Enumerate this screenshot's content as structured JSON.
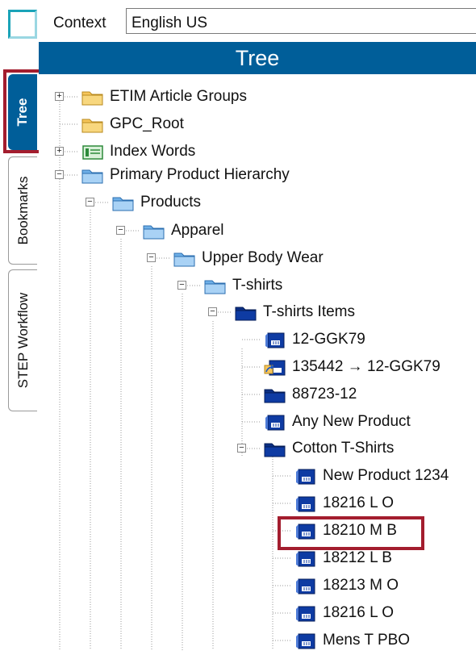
{
  "context": {
    "label": "Context",
    "value": "English US"
  },
  "left_tabs": [
    {
      "label": "Tree",
      "active": true
    },
    {
      "label": "Bookmarks",
      "active": false
    },
    {
      "label": "STEP Workflow",
      "active": false
    }
  ],
  "panel": {
    "title": "Tree"
  },
  "colors": {
    "header_blue": "#005e99",
    "highlight_red": "#a31d2e",
    "accent_teal": "#1aa3b8"
  },
  "tree": [
    {
      "label": "ETIM Article Groups",
      "icon": "folder-yellow-icon",
      "expander": "+"
    },
    {
      "label": "GPC_Root",
      "icon": "folder-yellow-icon",
      "expander": ""
    },
    {
      "label": "Index Words",
      "icon": "index-book-icon",
      "expander": "+"
    },
    {
      "label": "Primary Product Hierarchy",
      "icon": "folder-blue-icon",
      "expander": "-"
    },
    {
      "label": "Products",
      "icon": "folder-blue-icon",
      "expander": "-"
    },
    {
      "label": "Apparel",
      "icon": "folder-blue-icon",
      "expander": "-"
    },
    {
      "label": "Upper Body Wear",
      "icon": "folder-blue-icon",
      "expander": "-"
    },
    {
      "label": "T-shirts",
      "icon": "folder-blue-icon",
      "expander": "-"
    },
    {
      "label": "T-shirts Items",
      "icon": "folder-navy-icon",
      "expander": "-"
    },
    {
      "label": "12-GGK79",
      "icon": "product-icon",
      "expander": ""
    },
    {
      "label": "135442 → 12-GGK79",
      "icon": "product-reference-icon",
      "expander": ""
    },
    {
      "label": "88723-12",
      "icon": "folder-navy-icon",
      "expander": ""
    },
    {
      "label": "Any New Product",
      "icon": "product-icon",
      "expander": ""
    },
    {
      "label": "Cotton T-Shirts",
      "icon": "folder-navy-icon",
      "expander": "-"
    },
    {
      "label": "New Product 1234",
      "icon": "product-icon",
      "expander": ""
    },
    {
      "label": "18216 L O",
      "icon": "product-icon",
      "expander": ""
    },
    {
      "label": "18210 M B",
      "icon": "product-icon",
      "expander": ""
    },
    {
      "label": "18212 L B",
      "icon": "product-icon",
      "expander": ""
    },
    {
      "label": "18213 M O",
      "icon": "product-icon",
      "expander": ""
    },
    {
      "label": "18216 L O",
      "icon": "product-icon",
      "expander": ""
    },
    {
      "label": "Mens T PBO",
      "icon": "product-icon",
      "expander": ""
    }
  ]
}
